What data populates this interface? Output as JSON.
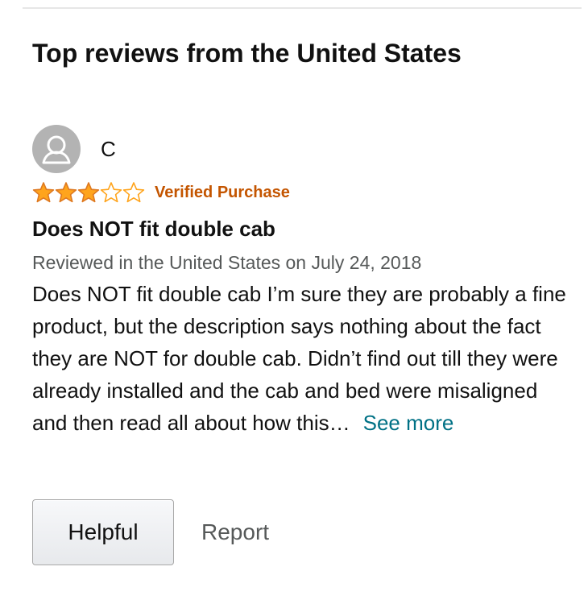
{
  "section": {
    "title": "Top reviews from the United States"
  },
  "review": {
    "author": "C",
    "avatar_icon": "default-user-icon",
    "rating": 3,
    "rating_max": 5,
    "star_color": "#ffa41c",
    "badge": "Verified Purchase",
    "badge_color": "#c45500",
    "title": "Does NOT fit double cab",
    "date_line": "Reviewed in the United States on July 24, 2018",
    "body_truncated": "Does NOT fit double cab I’m sure they are probably a fine product, but the description says nothing about the fact they are NOT for double cab. Didn’t find out till they were already installed and the cab and bed were misaligned and then read all about how this…",
    "see_more_label": "See more",
    "link_color": "#007185"
  },
  "actions": {
    "helpful_label": "Helpful",
    "report_label": "Report"
  }
}
